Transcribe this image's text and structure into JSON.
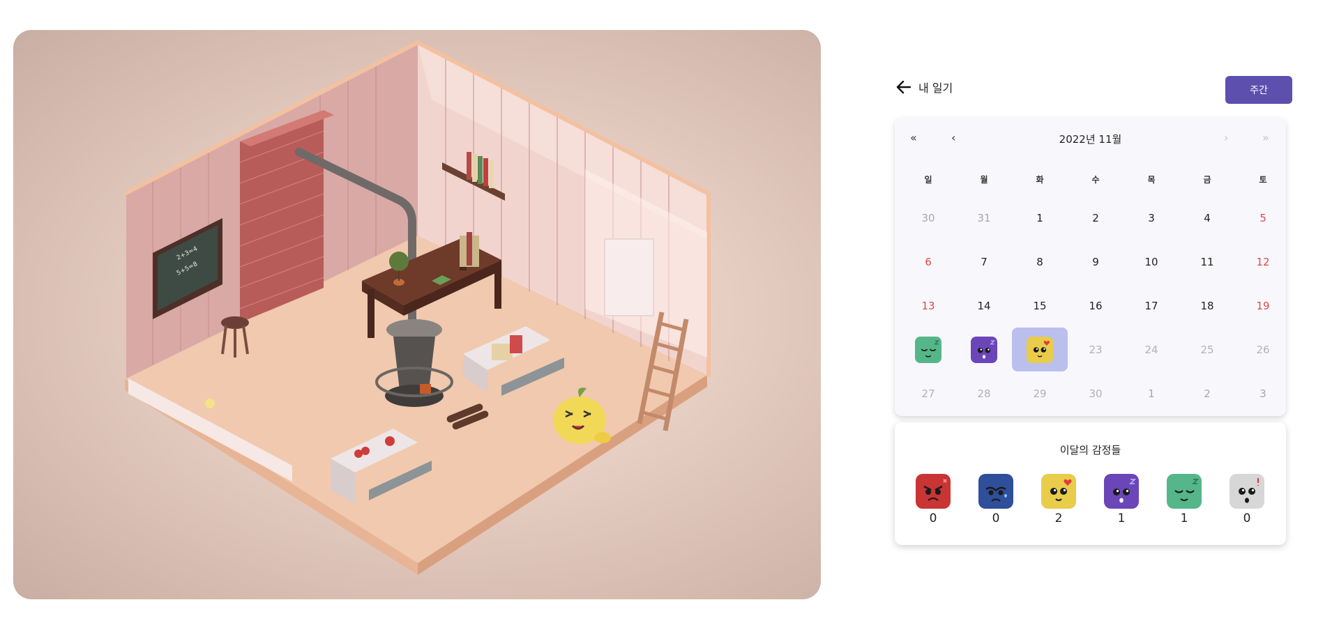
{
  "header": {
    "back_label": "내 일기",
    "weekly_button": "주간"
  },
  "calendar": {
    "title": "2022년 11월",
    "nav": {
      "prev_year": "«",
      "prev_month": "‹",
      "next_month": "›",
      "next_year": "»"
    },
    "weekdays": [
      "일",
      "월",
      "화",
      "수",
      "목",
      "금",
      "토"
    ],
    "weeks": [
      [
        "30",
        "31",
        "1",
        "2",
        "3",
        "4",
        "5"
      ],
      [
        "6",
        "7",
        "8",
        "9",
        "10",
        "11",
        "12"
      ],
      [
        "13",
        "14",
        "15",
        "16",
        "17",
        "18",
        "19"
      ],
      [
        "",
        "",
        "",
        "23",
        "24",
        "25",
        "26"
      ],
      [
        "27",
        "28",
        "29",
        "30",
        "1",
        "2",
        "3"
      ]
    ],
    "day_emotions": {
      "3-0": "calm",
      "3-1": "sleepy",
      "3-2": "love"
    }
  },
  "stats": {
    "title": "이달의 감정들",
    "emotions": [
      {
        "name": "angry",
        "color": "#c93434",
        "count": "0"
      },
      {
        "name": "sad",
        "color": "#2f4f9b",
        "count": "0"
      },
      {
        "name": "love",
        "color": "#e8cc4a",
        "count": "2"
      },
      {
        "name": "sleepy",
        "color": "#6b46b8",
        "count": "1"
      },
      {
        "name": "calm",
        "color": "#55b689",
        "count": "1"
      },
      {
        "name": "surprised",
        "color": "#d7d7d7",
        "count": "0"
      }
    ]
  },
  "colors": {
    "accent": "#5d4fad",
    "selected": "#bbbfee",
    "weekend": "#e04848"
  },
  "scene": {
    "chalkboard_lines": [
      "2+3=4",
      "5+5=8"
    ]
  }
}
